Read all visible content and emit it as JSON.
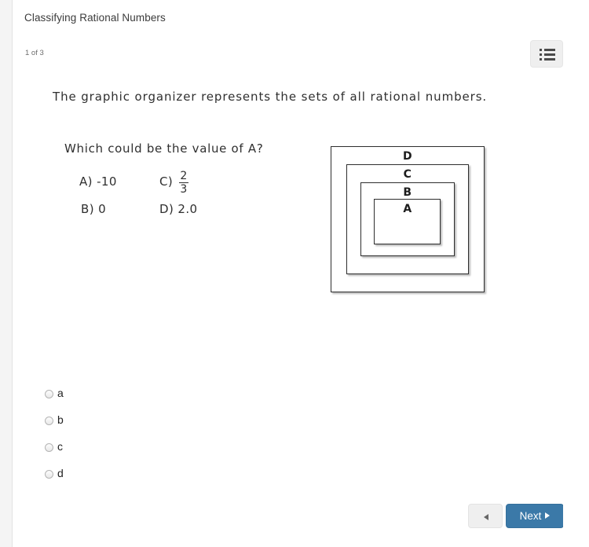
{
  "header": {
    "lesson_title": "Classifying Rational Numbers",
    "progress": "1 of 3",
    "menu_icon": "list-icon"
  },
  "question": {
    "stem": "The graphic organizer represents the sets of all rational numbers.",
    "prompt": "Which could be the value of A?",
    "choices": [
      {
        "key": "A)",
        "text": "-10"
      },
      {
        "key": "B)",
        "text": "0"
      },
      {
        "key": "C)",
        "numerator": "2",
        "denominator": "3"
      },
      {
        "key": "D)",
        "text": "2.0"
      }
    ],
    "diagram": {
      "description": "nested-sets-graphic-organizer",
      "labels": [
        "D",
        "C",
        "B",
        "A"
      ]
    }
  },
  "answers": {
    "options": [
      {
        "value": "a",
        "label": "a",
        "selected": false
      },
      {
        "value": "b",
        "label": "b",
        "selected": false
      },
      {
        "value": "c",
        "label": "c",
        "selected": false
      },
      {
        "value": "d",
        "label": "d",
        "selected": false
      }
    ]
  },
  "footer": {
    "prev_label": "",
    "prev_icon": "triangle-left-icon",
    "next_label": "Next",
    "next_icon": "triangle-right-icon"
  },
  "colors": {
    "accent_blue": "#3b79a8",
    "button_gray": "#efefef",
    "scrollbar": "#7b7b7b",
    "text_dark": "#2f2f2f"
  }
}
